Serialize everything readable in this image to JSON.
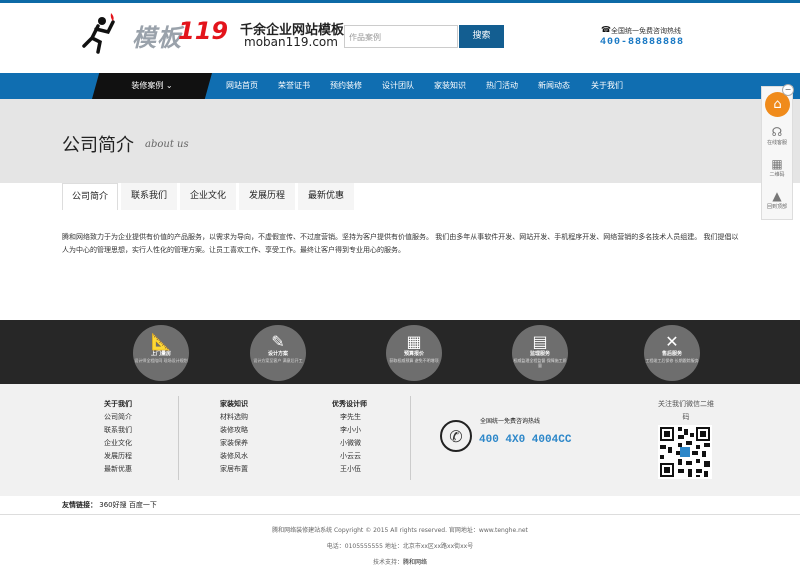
{
  "header": {
    "brand_cn": "模板",
    "brand_num": "119",
    "tagline": "千余企业网站模板",
    "domain": "moban119.com",
    "search_placeholder": "作品案例",
    "search_button": "搜索",
    "hotline_label": "全国统一免费咨询热线",
    "hotline_number": "400-88888888"
  },
  "nav": {
    "cases": "装修案例 ⌄",
    "items": [
      "网站首页",
      "荣誉证书",
      "预约装修",
      "设计团队",
      "家装知识",
      "热门活动",
      "新闻动态",
      "关于我们"
    ]
  },
  "banner": {
    "title": "公司简介",
    "subtitle": "about us"
  },
  "tabs": [
    "公司简介",
    "联系我们",
    "企业文化",
    "发展历程",
    "最新优惠"
  ],
  "content": {
    "paragraph": "腾和网络致力于为企业提供有价值的产品服务，以需求为导向，不虚假宣传、不过度营销。坚持为客户提供有价值服务。 我们由多年从事软件开发、网站开发、手机程序开发、网络营销的多名技术人员组建。 我们提倡以人为中心的管理思想，实行人性化的管理方案。让员工喜欢工作、享受工作。最终让客户得到专业用心的服务。"
  },
  "services": [
    {
      "icon": "ruler-icon",
      "title": "上门量房",
      "desc": "设计师全程陪同 现场设计规划"
    },
    {
      "icon": "designer-icon",
      "title": "设计方案",
      "desc": "设计方案至客户 满意后开工"
    },
    {
      "icon": "calculator-icon",
      "title": "预算报价",
      "desc": "获取权威预算 避免不明增项"
    },
    {
      "icon": "clipboard-icon",
      "title": "监理服务",
      "desc": "权威监理全程监督 保障施工质量"
    },
    {
      "icon": "tools-icon",
      "title": "售后服务",
      "desc": "工程竣工后保修 长期跟踪服务"
    }
  ],
  "footer": {
    "columns": [
      {
        "heading": "关于我们",
        "items": [
          "公司简介",
          "联系我们",
          "企业文化",
          "发展历程",
          "最新优惠"
        ]
      },
      {
        "heading": "家装知识",
        "items": [
          "材料选购",
          "装修攻略",
          "家装保养",
          "装修风水",
          "家居布置"
        ]
      },
      {
        "heading": "优秀设计师",
        "items": [
          "李先生",
          "李小小",
          "小微微",
          "小云云",
          "王小伍"
        ]
      }
    ],
    "hotline_label": "全国统一免费咨询热线",
    "hotline_number": "400 4X0 4004CC",
    "qr_label": "关注我们微信二维码"
  },
  "links": {
    "label": "友情链接：",
    "items": [
      "360好搜",
      "百度一下"
    ]
  },
  "copyright": {
    "line1": "腾和网络装修建站系统 Copyright © 2015 All rights reserved. 官网地址：www.tenghe.net",
    "line2": "电话：0105555555 地址：北京市xx区xx路xx街xx号",
    "line3_label": "技术支持：",
    "line3_link": "腾和网络"
  },
  "sidebar": {
    "close": "−",
    "service": "在线客服",
    "qr": "二维码",
    "top": "回到顶部"
  },
  "colors": {
    "nav": "#106eb1",
    "dark": "#272727",
    "accent": "#f08b1b",
    "hotline": "#1a79c4"
  }
}
